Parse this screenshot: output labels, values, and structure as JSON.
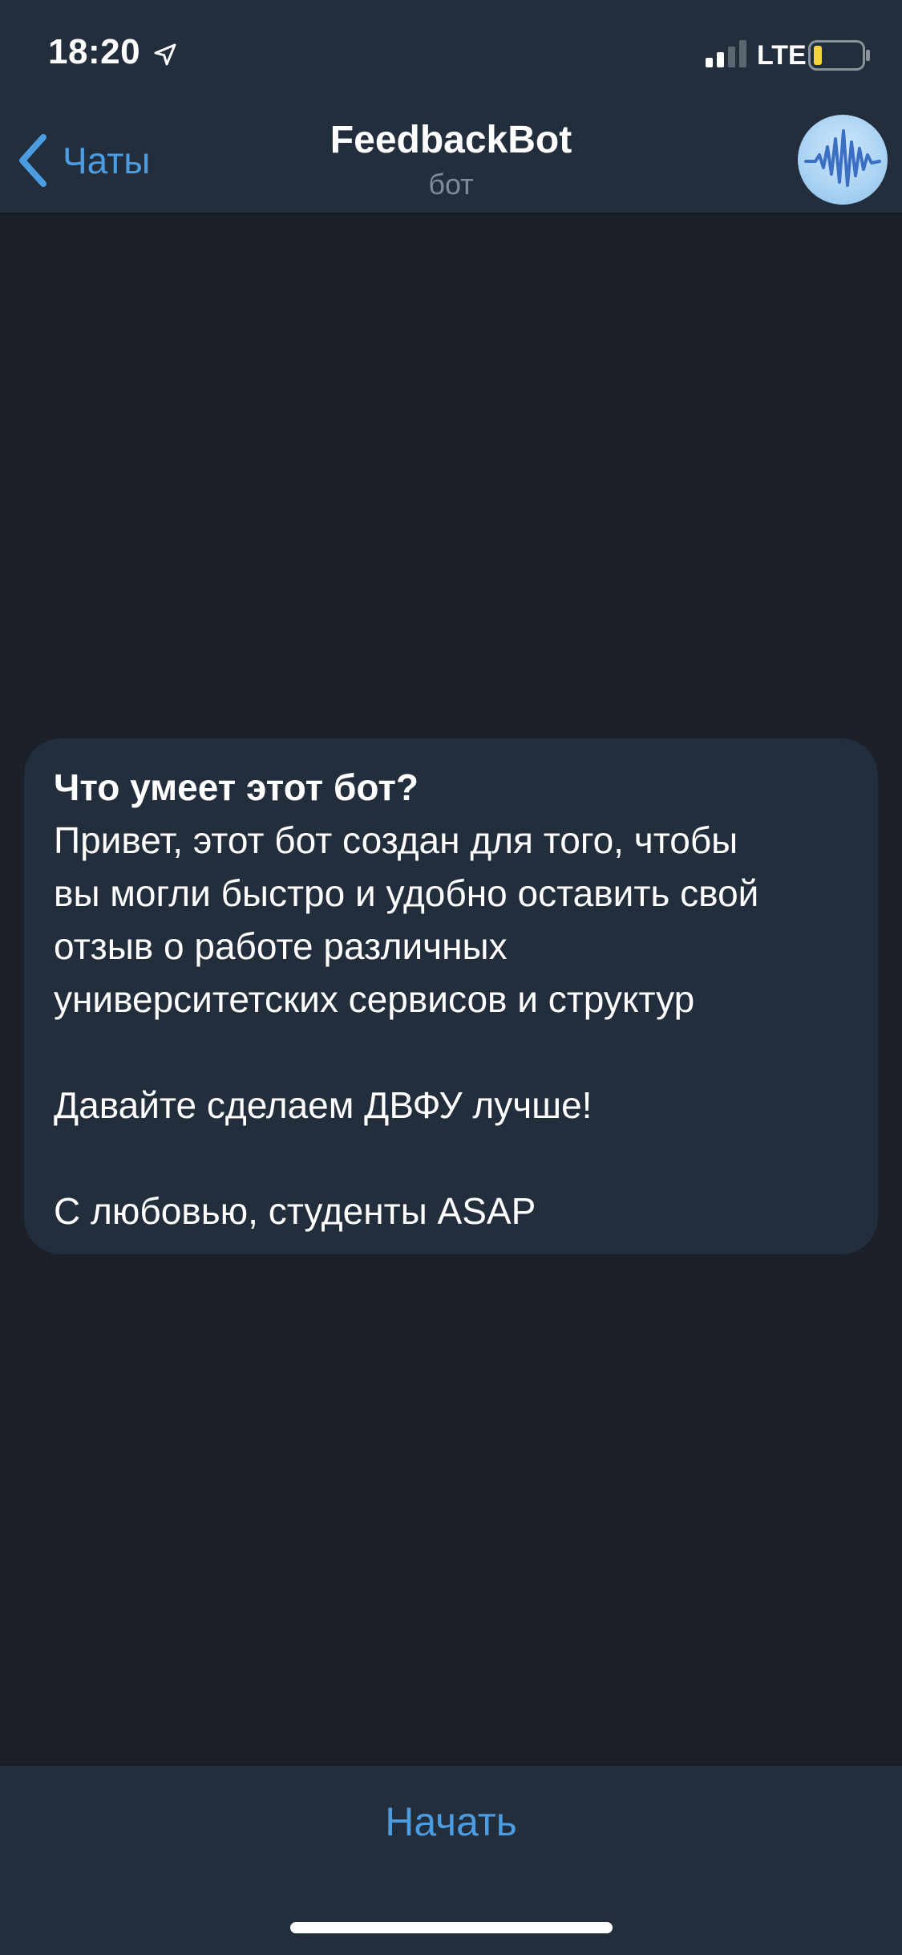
{
  "status_bar": {
    "time": "18:20",
    "network": "LTE",
    "icons": [
      "location-arrow-icon",
      "signal-icon",
      "battery-icon"
    ]
  },
  "header": {
    "back_label": "Чаты",
    "title": "FeedbackBot",
    "subtitle": "бот",
    "avatar_icon": "sound-wave-icon"
  },
  "bot_info": {
    "title": "Что умеет этот бот?",
    "text": "Привет, этот бот создан для того, чтобы\nвы могли быстро и удобно оставить свой\nотзыв о работе различных\nуниверситетских сервисов и структур\n\nДавайте сделаем ДВФУ лучше!\n\nС любовью, студенты ASAP"
  },
  "bottom": {
    "start_label": "Начать"
  },
  "colors": {
    "background": "#1b2029",
    "panel": "#232e3c",
    "accent": "#4c9ce2",
    "subtitle": "#7d8b99",
    "battery_level": "#f5d33f"
  }
}
